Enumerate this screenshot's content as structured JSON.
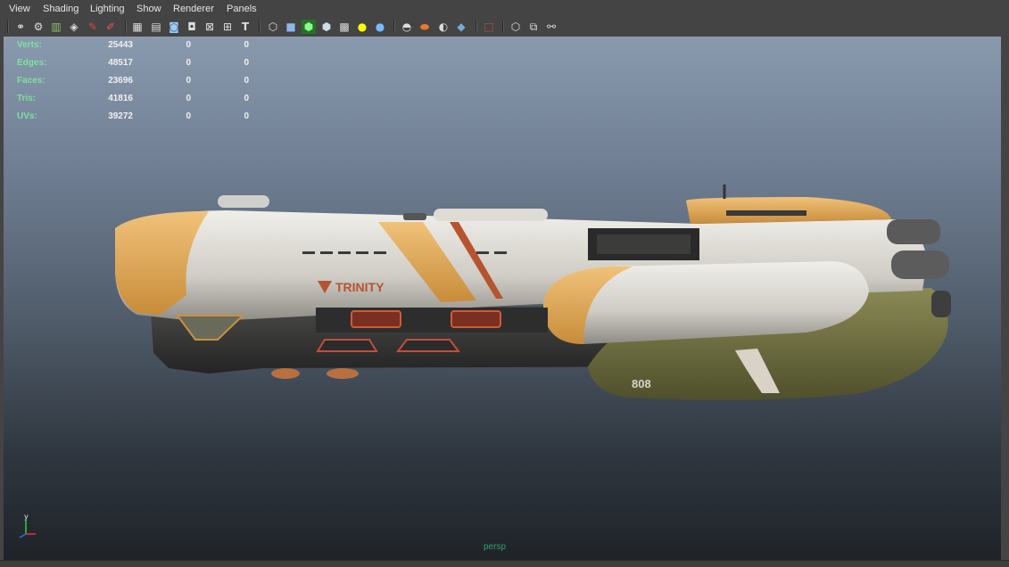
{
  "menubar": {
    "items": [
      "View",
      "Shading",
      "Lighting",
      "Show",
      "Renderer",
      "Panels"
    ]
  },
  "toolbar": {
    "icons": [
      "camera-select-icon",
      "camera-attributes-icon",
      "bookmark-icon",
      "image-plane-icon",
      "grease-pencil-icon",
      "2d-pan-zoom-icon",
      "grid-icon",
      "film-gate-icon",
      "resolution-gate-icon",
      "gate-mask-icon",
      "field-chart-icon",
      "safe-action-icon",
      "safe-title-icon",
      "wireframe-icon",
      "smooth-shade-icon",
      "wireframe-on-shaded-icon",
      "default-material-icon",
      "textured-icon",
      "use-lights-icon",
      "shadows-icon",
      "screen-space-ao-icon",
      "motion-blur-icon",
      "multisample-aa-icon",
      "depth-of-field-icon",
      "xray-icon",
      "isolate-select-icon",
      "xray-joints-icon",
      "xray-components-icon"
    ]
  },
  "hud": {
    "rows": [
      {
        "label": "Verts:",
        "v1": "25443",
        "v2": "0",
        "v3": "0"
      },
      {
        "label": "Edges:",
        "v1": "48517",
        "v2": "0",
        "v3": "0"
      },
      {
        "label": "Faces:",
        "v1": "23696",
        "v2": "0",
        "v3": "0"
      },
      {
        "label": "Tris:",
        "v1": "41816",
        "v2": "0",
        "v3": "0"
      },
      {
        "label": "UVs:",
        "v1": "39272",
        "v2": "0",
        "v3": "0"
      }
    ]
  },
  "viewport": {
    "camera": "persp",
    "axis_x": "x",
    "axis_y": "y"
  },
  "model": {
    "hull_text": "TRINITY",
    "hull_number": "808",
    "colors": {
      "hull": "#d9d7d2",
      "accent": "#e0a84a",
      "stripe": "#b5542e",
      "belly": "#6f6f3c"
    }
  }
}
